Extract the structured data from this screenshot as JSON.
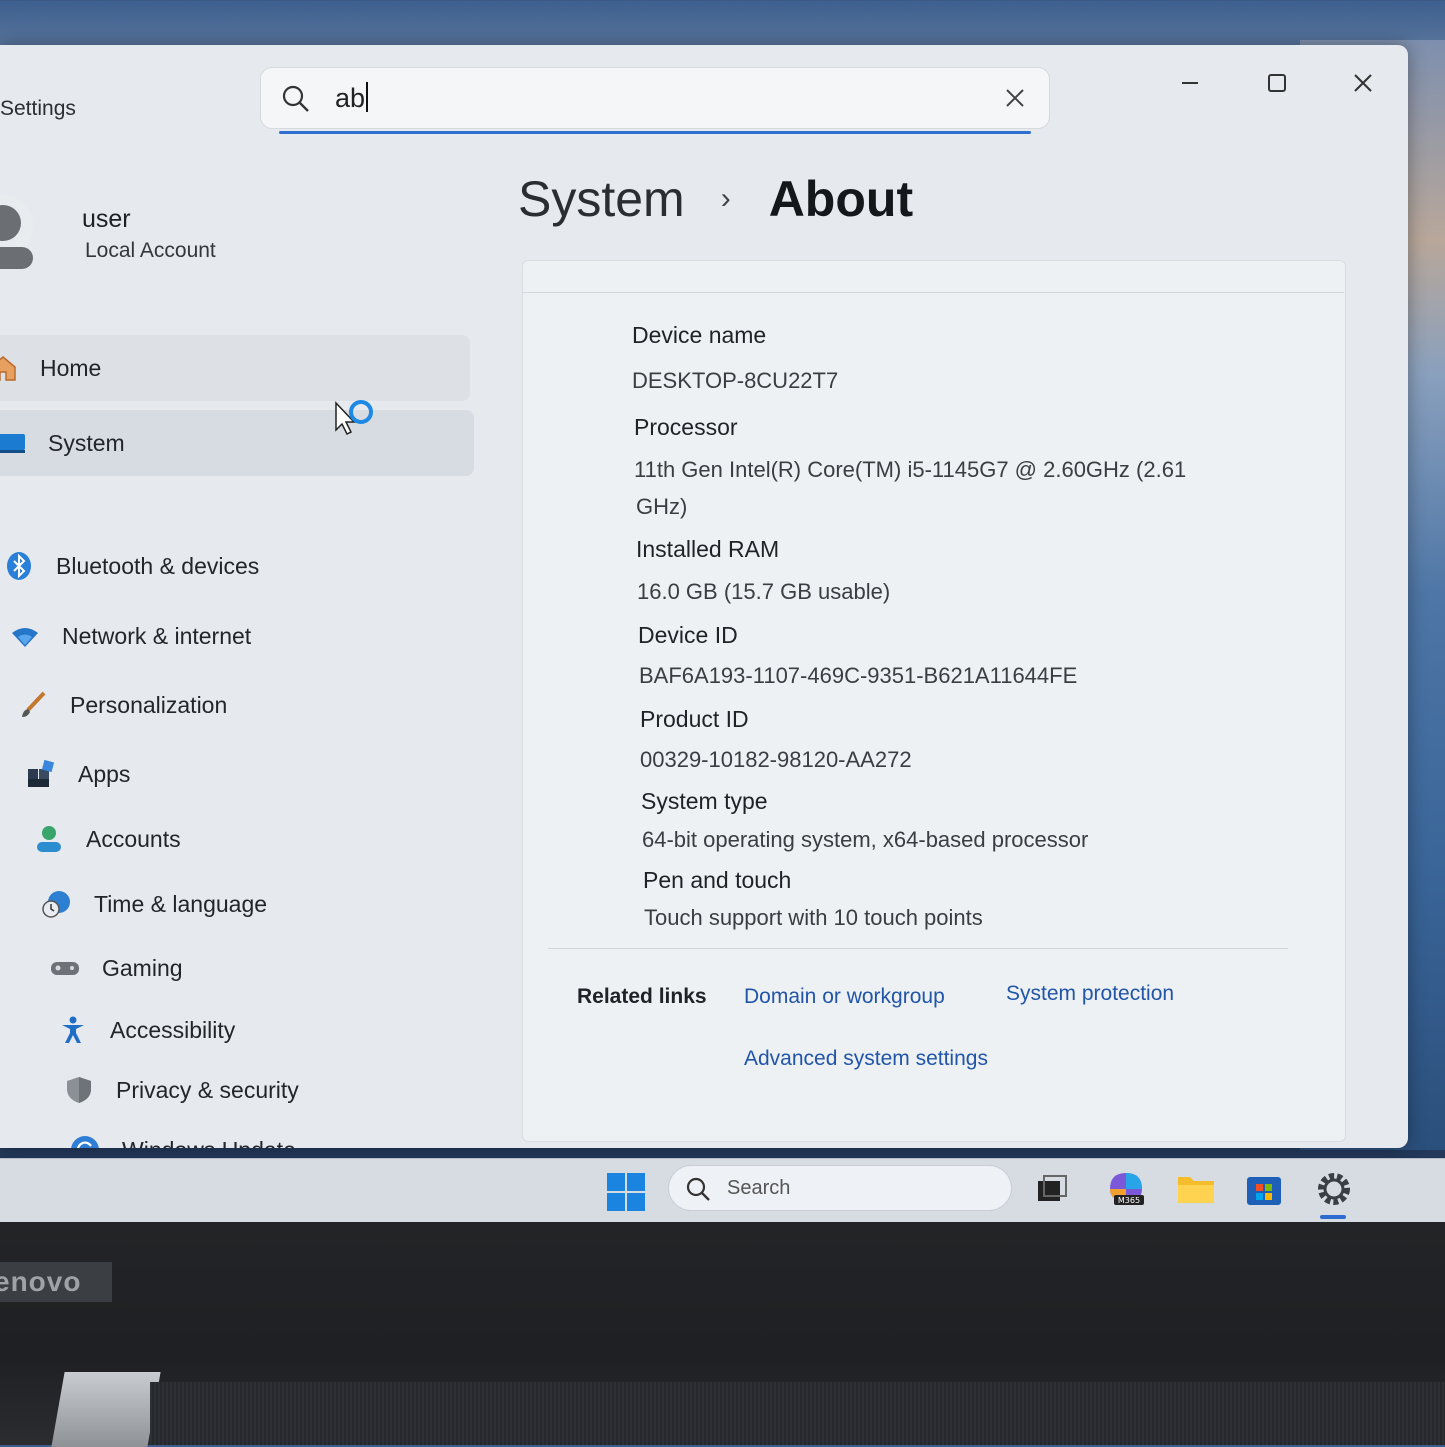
{
  "app": {
    "title": "Settings"
  },
  "search": {
    "value": "ab"
  },
  "user": {
    "name": "user",
    "account_type": "Local Account"
  },
  "nav": {
    "items": [
      {
        "label": "Home",
        "icon": "home-icon"
      },
      {
        "label": "System",
        "icon": "monitor-icon"
      },
      {
        "label": "Bluetooth & devices",
        "icon": "bluetooth-icon"
      },
      {
        "label": "Network & internet",
        "icon": "wifi-icon"
      },
      {
        "label": "Personalization",
        "icon": "brush-icon"
      },
      {
        "label": "Apps",
        "icon": "apps-icon"
      },
      {
        "label": "Accounts",
        "icon": "person-icon"
      },
      {
        "label": "Time & language",
        "icon": "globe-clock-icon"
      },
      {
        "label": "Gaming",
        "icon": "gamepad-icon"
      },
      {
        "label": "Accessibility",
        "icon": "accessibility-icon"
      },
      {
        "label": "Privacy & security",
        "icon": "shield-icon"
      },
      {
        "label": "Windows Update",
        "icon": "update-icon"
      }
    ],
    "selected": "System"
  },
  "breadcrumb": {
    "parent": "System",
    "separator": "›",
    "current": "About"
  },
  "specs": {
    "device_name": {
      "label": "Device name",
      "value": "DESKTOP-8CU22T7"
    },
    "processor": {
      "label": "Processor",
      "value_line1": "11th Gen Intel(R) Core(TM) i5-1145G7 @ 2.60GHz (2.61",
      "value_line2": "GHz)"
    },
    "ram": {
      "label": "Installed RAM",
      "value": "16.0 GB (15.7 GB usable)"
    },
    "device_id": {
      "label": "Device ID",
      "value": "BAF6A193-1107-469C-9351-B621A11644FE"
    },
    "product_id": {
      "label": "Product ID",
      "value": "00329-10182-98120-AA272"
    },
    "system_type": {
      "label": "System type",
      "value": "64-bit operating system, x64-based processor"
    },
    "pen_touch": {
      "label": "Pen and touch",
      "value": "Touch support with 10 touch points"
    }
  },
  "related": {
    "title": "Related links",
    "links": [
      "Domain or workgroup",
      "System protection",
      "Advanced system settings"
    ]
  },
  "taskbar": {
    "search_placeholder": "Search",
    "m365_badge": "M365"
  },
  "laptop": {
    "brand": "enovo"
  },
  "colors": {
    "accent": "#2f6fd0",
    "link": "#2155a8",
    "window_bg": "#e6eaee"
  }
}
